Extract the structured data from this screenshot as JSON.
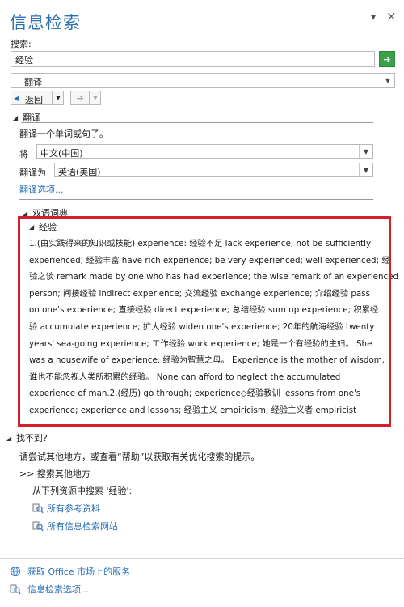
{
  "pane": {
    "title": "信息检索",
    "dropdown_glyph": "▾",
    "close_glyph": "×"
  },
  "search": {
    "label": "搜索:",
    "value": "经验",
    "go_glyph": "➔"
  },
  "service": {
    "selected": "翻译"
  },
  "nav": {
    "back_label": "返回",
    "back_glyph": "◂",
    "forward_glyph": "➔"
  },
  "translate": {
    "header": "翻译",
    "description": "翻译一个单词或句子。",
    "from_label": "将",
    "from_value": "中文(中国)",
    "to_label": "翻译为",
    "to_value": "英语(美国)",
    "options_link": "翻译选项..."
  },
  "dictionary": {
    "header": "双语词典",
    "term": "经验",
    "lines": [
      "1.(由实践得来的知识或技能) experience: 经验不足 lack experience; not be sufficiently",
      "experienced; 经验丰富 have rich experience; be very experienced; well experienced; 经",
      "验之谈 remark made by one who has had experience; the wise remark of an experienced",
      "person; 间接经验 indirect experience; 交流经验 exchange experience; 介绍经验 pass",
      "on one's experience; 直接经验 direct experience; 总结经验 sum up experience; 积累经",
      "验 accumulate experience; 扩大经验 widen one's experience; 20年的航海经验 twenty",
      "years' sea-going experience; 工作经验 work experience; 她是一个有经验的主妇。 She",
      "was a housewife of experience. 经验为智慧之母。 Experience is the mother of wisdom.",
      "谁也不能忽视人类所积累的经验。 None can afford to neglect the accumulated",
      "experience of man.2.(经历) go through; experience◇经验教训 lessons from one's",
      "experience; experience and lessons; 经验主义 empiricism; 经验主义者 empiricist"
    ]
  },
  "not_found": {
    "header": "找不到?",
    "hint": "请尝试其他地方，或查看“帮助”以获取有关优化搜索的提示。",
    "search_elsewhere": ">> 搜索其他地方",
    "from_resources": "从下列资源中搜索 '经验':",
    "all_reference": "所有参考资料",
    "all_research_sites": "所有信息检索网站"
  },
  "footer": {
    "office_market": "获取 Office 市场上的服务",
    "research_options": "信息检索选项..."
  },
  "colors": {
    "title": "#2b6fb6",
    "highlight_border": "#d51f2b",
    "go_button": "#3aa14a"
  }
}
